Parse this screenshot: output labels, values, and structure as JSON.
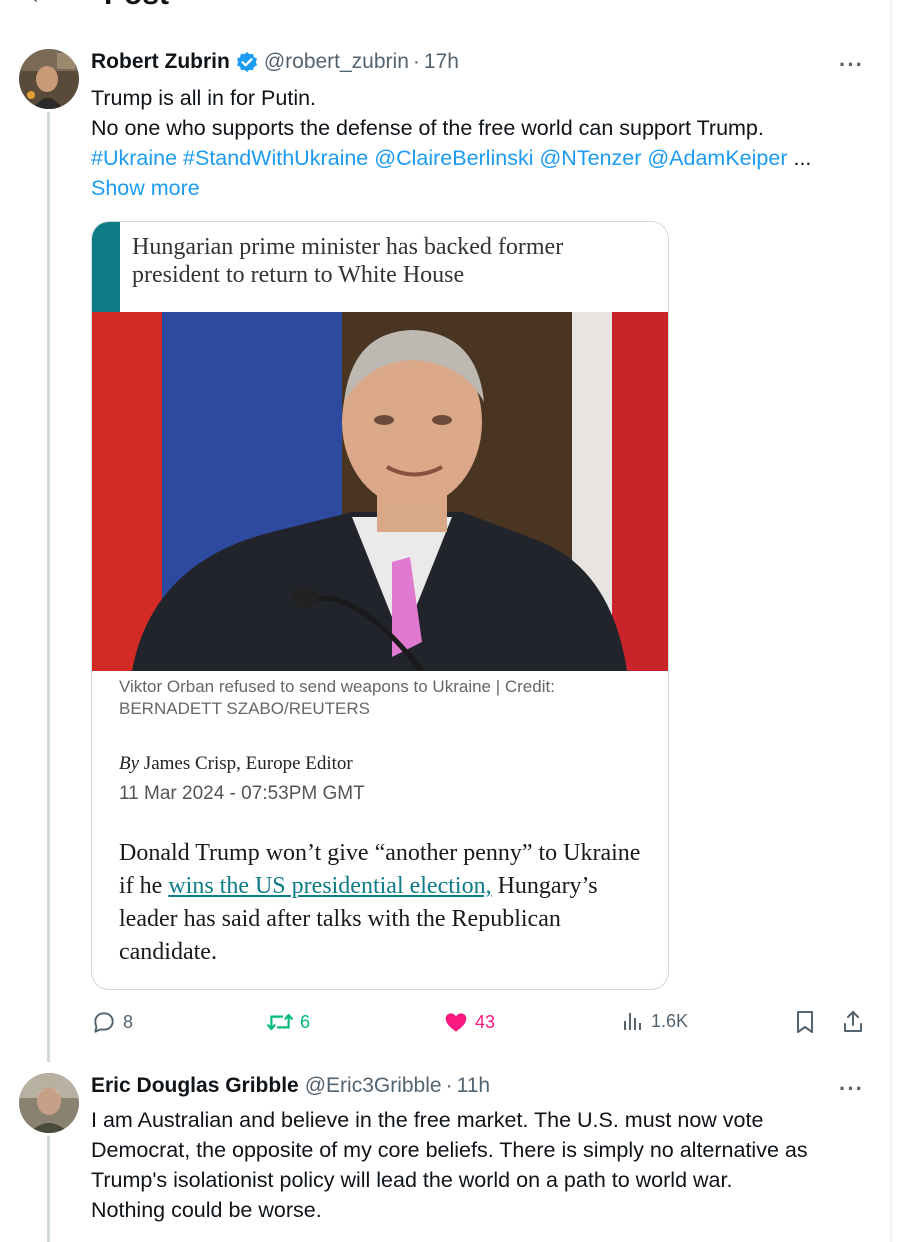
{
  "page": {
    "title": "Post"
  },
  "post1": {
    "name": "Robert Zubrin",
    "handle": "@robert_zubrin",
    "separator": "·",
    "time": "17h",
    "line1": "Trump is all in for Putin.",
    "line2": "No one who supports the defense of the free world can support Trump.",
    "tags": [
      "#Ukraine",
      "#StandWithUkraine",
      "@ClaireBerlinski",
      "@NTenzer",
      "@AdamKeiper"
    ],
    "ellipsis": "...",
    "show_more": "Show more",
    "more": "···",
    "card": {
      "headline": "Hungarian prime minister has backed former president to return to White House",
      "caption": "Viktor Orban refused to send weapons to Ukraine | Credit: BERNADETT SZABO/REUTERS",
      "by_word": "By",
      "byline": "James Crisp, Europe Editor",
      "date": "11 Mar 2024 - 07:53PM GMT",
      "body_pre": "Donald Trump won’t give “another penny” to Ukraine if he ",
      "body_link": "wins the US presidential election,",
      "body_post": " Hungary’s leader has said after talks with the Republican candidate."
    },
    "stats": {
      "replies": "8",
      "reposts": "6",
      "likes": "43",
      "views": "1.6K"
    }
  },
  "post2": {
    "name": "Eric Douglas Gribble",
    "handle": "@Eric3Gribble",
    "separator": "·",
    "time": "11h",
    "more": "···",
    "lines": [
      "I am Australian and believe in the free market. The U.S. must now vote",
      "Democrat, the opposite of my core beliefs. There is simply no alternative as",
      "Trump's isolationist policy will lead the world on a path to world war.",
      "Nothing could be worse."
    ]
  },
  "colors": {
    "accent": "#1d9bf0",
    "like": "#f91880",
    "repost": "#00ba7c",
    "muted": "#536471",
    "card_accent": "#0e7c86"
  }
}
